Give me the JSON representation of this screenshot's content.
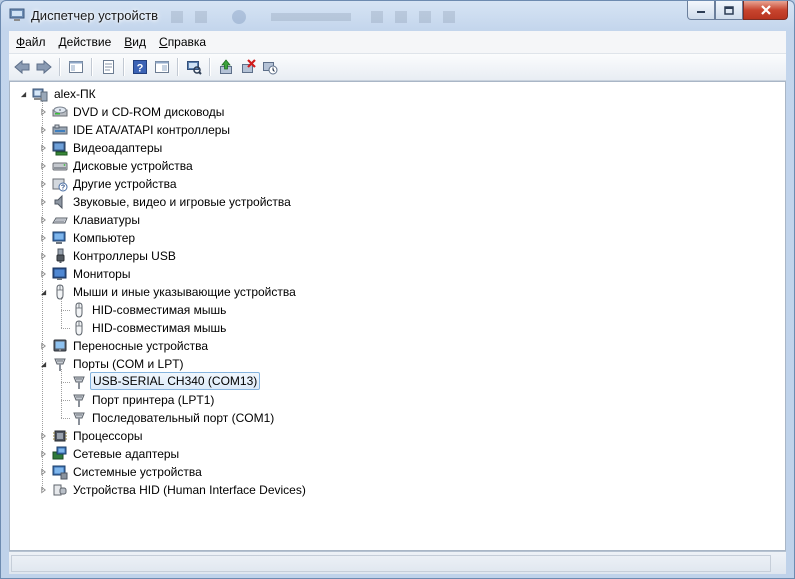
{
  "window": {
    "title": "Диспетчер устройств"
  },
  "menu": [
    {
      "label": "Файл",
      "hot": "Ф",
      "rest": "айл"
    },
    {
      "label": "Действие",
      "hot": "Д",
      "rest": "ействие"
    },
    {
      "label": "Вид",
      "hot": "В",
      "rest": "ид"
    },
    {
      "label": "Справка",
      "hot": "С",
      "rest": "правка"
    }
  ],
  "toolbar": [
    "back-icon",
    "forward-icon",
    "console-tree-icon",
    "properties-icon",
    "help-icon",
    "view-icon",
    "scan-hardware-icon",
    "update-driver-icon",
    "uninstall-icon",
    "disable-icon"
  ],
  "tree": {
    "root": "alex-ПК",
    "categories": [
      {
        "label": "DVD и CD-ROM дисководы",
        "icon": "dvd-drive-icon",
        "expanded": false
      },
      {
        "label": "IDE ATA/ATAPI контроллеры",
        "icon": "ide-controller-icon",
        "expanded": false
      },
      {
        "label": "Видеоадаптеры",
        "icon": "display-adapter-icon",
        "expanded": false
      },
      {
        "label": "Дисковые устройства",
        "icon": "disk-drive-icon",
        "expanded": false
      },
      {
        "label": "Другие устройства",
        "icon": "unknown-device-icon",
        "expanded": false
      },
      {
        "label": "Звуковые, видео и игровые устройства",
        "icon": "speaker-icon",
        "expanded": false
      },
      {
        "label": "Клавиатуры",
        "icon": "keyboard-icon",
        "expanded": false
      },
      {
        "label": "Компьютер",
        "icon": "computer-icon",
        "expanded": false
      },
      {
        "label": "Контроллеры USB",
        "icon": "usb-icon",
        "expanded": false
      },
      {
        "label": "Мониторы",
        "icon": "monitor-icon",
        "expanded": false
      },
      {
        "label": "Мыши и иные указывающие устройства",
        "icon": "mouse-icon",
        "expanded": true,
        "children": [
          {
            "label": "HID-совместимая мышь",
            "icon": "mouse-icon"
          },
          {
            "label": "HID-совместимая мышь",
            "icon": "mouse-icon"
          }
        ]
      },
      {
        "label": "Переносные устройства",
        "icon": "portable-device-icon",
        "expanded": false
      },
      {
        "label": "Порты (COM и LPT)",
        "icon": "port-icon",
        "expanded": true,
        "children": [
          {
            "label": "USB-SERIAL CH340 (COM13)",
            "icon": "port-icon",
            "selected": true
          },
          {
            "label": "Порт принтера (LPT1)",
            "icon": "port-icon"
          },
          {
            "label": "Последовательный порт (COM1)",
            "icon": "port-icon"
          }
        ]
      },
      {
        "label": "Процессоры",
        "icon": "processor-icon",
        "expanded": false
      },
      {
        "label": "Сетевые адаптеры",
        "icon": "network-adapter-icon",
        "expanded": false
      },
      {
        "label": "Системные устройства",
        "icon": "system-device-icon",
        "expanded": false
      },
      {
        "label": "Устройства HID (Human Interface Devices)",
        "icon": "hid-icon",
        "expanded": false
      }
    ]
  },
  "colors": {
    "selection_border": "#86b4de",
    "close_button": "#c8452f",
    "title_bar": "#c3d5ec"
  }
}
